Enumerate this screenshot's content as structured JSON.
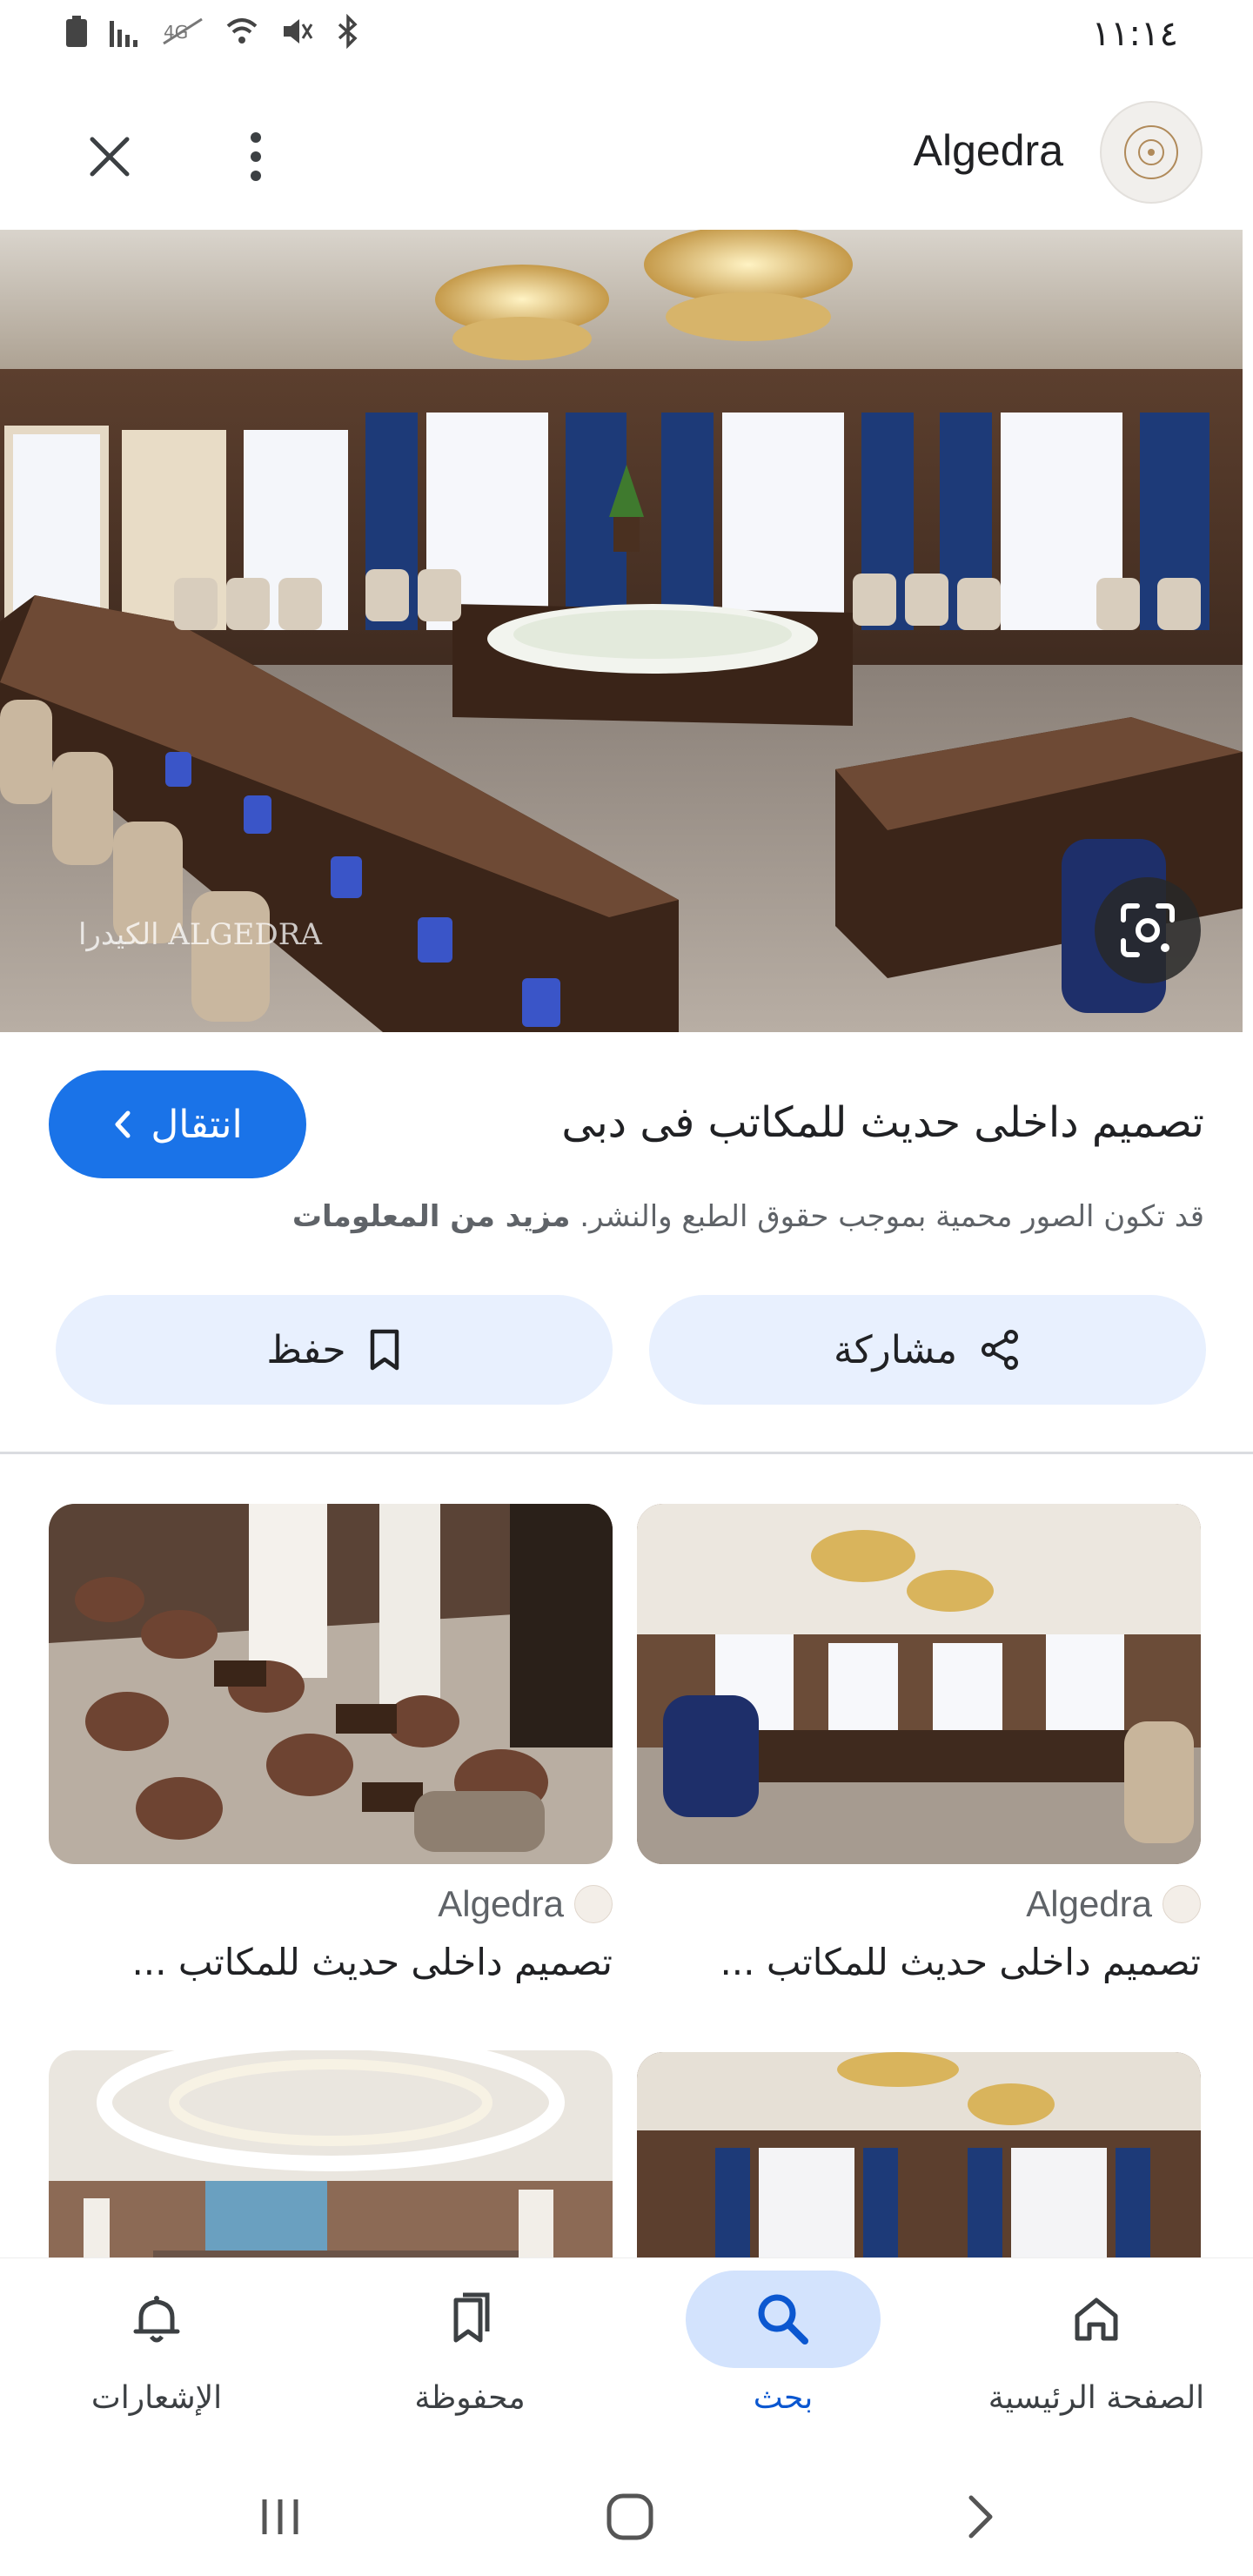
{
  "status_bar": {
    "time": "١١:١٤"
  },
  "app_bar": {
    "site_name": "Algedra",
    "logo_text": "الكيدرا ALGEDRA"
  },
  "hero": {
    "watermark": "الكيدرا ALGEDRA"
  },
  "result": {
    "title": "تصميم داخلى حديث للمكاتب فى دبى",
    "visit_label": "انتقال",
    "copyright_text": "قد تكون الصور محمية بموجب حقوق الطبع والنشر.",
    "more_info": "مزيد من المعلومات"
  },
  "actions": {
    "share_label": "مشاركة",
    "save_label": "حفظ"
  },
  "related": [
    {
      "source": "Algedra",
      "title": "تصميم داخلى حديث للمكاتب ..."
    },
    {
      "source": "Algedra",
      "title": "تصميم داخلى حديث للمكاتب ..."
    }
  ],
  "bottom_nav": {
    "items": [
      {
        "label": "الصفحة الرئيسية",
        "icon": "home-icon"
      },
      {
        "label": "بحث",
        "icon": "search-icon"
      },
      {
        "label": "محفوظة",
        "icon": "bookmarks-icon"
      },
      {
        "label": "الإشعارات",
        "icon": "bell-icon"
      }
    ],
    "active": "بحث"
  },
  "colors": {
    "accent": "#1a73e8",
    "chip_bg": "#e8f0fe",
    "nav_active_bg": "#d3e3fd"
  }
}
